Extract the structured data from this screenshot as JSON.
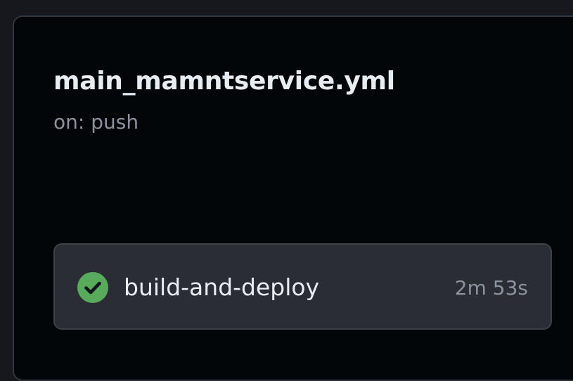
{
  "workflow": {
    "title": "main_mamntservice.yml",
    "trigger": "on: push"
  },
  "job": {
    "name": "build-and-deploy",
    "duration": "2m 53s",
    "status": "success",
    "status_icon": "check-circle-icon",
    "status_color": "#57ab5a"
  },
  "colors": {
    "panel_background": "#030609",
    "card_background": "#2a2d33",
    "primary_text": "#e6edf3",
    "secondary_text": "#8b949e"
  }
}
